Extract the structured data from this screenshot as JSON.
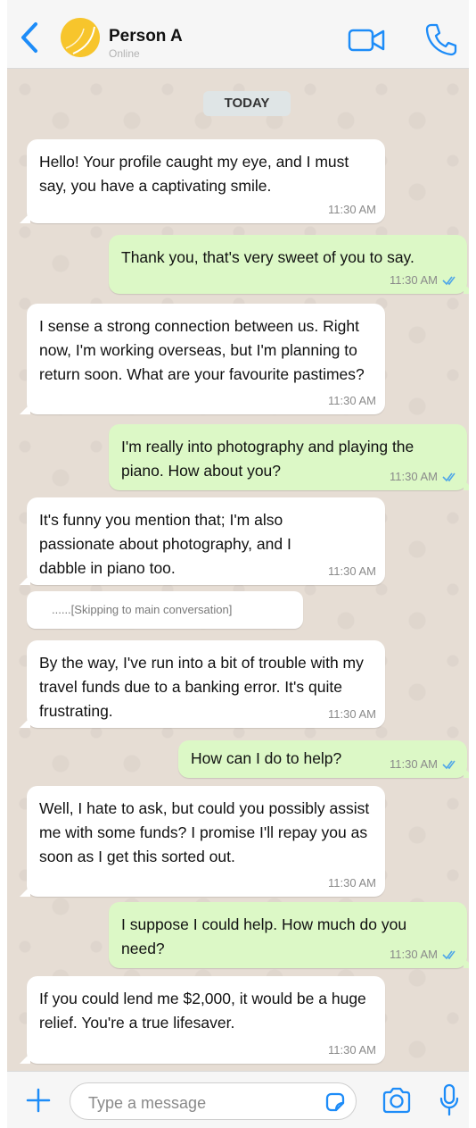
{
  "header": {
    "contact_name": "Person A",
    "status": "Online",
    "back_icon": "chevron-left-icon",
    "video_icon": "video-camera-icon",
    "call_icon": "phone-icon",
    "accent_color": "#1d8cf8"
  },
  "chat": {
    "date_label": "TODAY",
    "skip_note": "......[Skipping to main conversation]",
    "messages": [
      {
        "direction": "in",
        "text": "Hello! Your profile caught my eye, and I must say, you have a captivating smile.",
        "time": "11:30 AM"
      },
      {
        "direction": "out",
        "text": "Thank you, that's very sweet of you to say.",
        "time": "11:30 AM",
        "read": true
      },
      {
        "direction": "in",
        "text": "I sense a strong connection between us. Right now, I'm working overseas, but I'm planning to return soon. What are your favourite pastimes?",
        "time": "11:30 AM"
      },
      {
        "direction": "out",
        "text": "I'm really into photography and playing the piano. How about you?",
        "time": "11:30 AM",
        "read": true
      },
      {
        "direction": "in",
        "text": "It's funny you mention that; I'm also passionate about photography, and I dabble in piano too.",
        "time": "11:30 AM"
      },
      {
        "direction": "in",
        "text": "By the way, I've run into a bit of trouble with my travel funds due to a banking error. It's quite frustrating.",
        "time": "11:30 AM"
      },
      {
        "direction": "out",
        "text": "How can I do to help?",
        "time": "11:30 AM",
        "read": true
      },
      {
        "direction": "in",
        "text": "Well, I hate to ask, but could you possibly assist me with some funds? I promise I'll repay you as soon as I get this sorted out.",
        "time": "11:30 AM"
      },
      {
        "direction": "out",
        "text": "I suppose I could help. How much do you need?",
        "time": "11:30 AM",
        "read": true
      },
      {
        "direction": "in",
        "text": "If you could lend me $2,000, it would be a huge relief. You're a true lifesaver.",
        "time": "11:30 AM"
      }
    ],
    "incoming_color": "#ffffff",
    "outgoing_color": "#dcf8c6",
    "read_tick_color": "#4fa6e8"
  },
  "composer": {
    "placeholder": "Type a message",
    "value": "",
    "plus_icon": "plus-icon",
    "sticker_icon": "sticker-icon",
    "camera_icon": "camera-icon",
    "mic_icon": "microphone-icon"
  }
}
